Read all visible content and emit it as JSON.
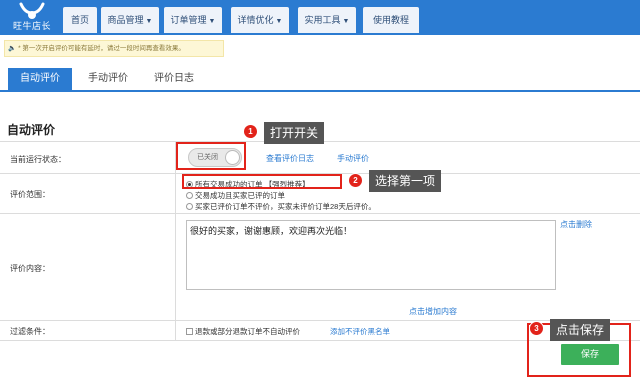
{
  "app": {
    "logo_text": "旺牛店长"
  },
  "nav": {
    "items": [
      {
        "label": "首页",
        "has_caret": false
      },
      {
        "label": "商品管理",
        "has_caret": true
      },
      {
        "label": "订单管理",
        "has_caret": true
      },
      {
        "label": "详情优化",
        "has_caret": true
      },
      {
        "label": "实用工具",
        "has_caret": true
      },
      {
        "label": "使用教程",
        "has_caret": false
      }
    ],
    "caret_icon": "chevron-down-icon"
  },
  "notice": {
    "text": "* 第一次开启评价可能有延时，请过一段时间再查看效果。",
    "icon": "speaker-icon"
  },
  "tabs": [
    {
      "label": "自动评价",
      "active": true
    },
    {
      "label": "手动评价",
      "active": false
    },
    {
      "label": "评价日志",
      "active": false
    }
  ],
  "section_title": "自动评价",
  "form": {
    "status": {
      "label": "当前运行状态：",
      "toggle_text": "已关闭",
      "toggle_on": false,
      "links": [
        "查看评价日志",
        "手动评价"
      ]
    },
    "scope": {
      "label": "评价范围：",
      "options": [
        {
          "text": "所有交易成功的订单 【强烈推荐】",
          "checked": true
        },
        {
          "text": "交易成功且买家已评的订单",
          "checked": false
        },
        {
          "text": "买家已评价订单不评价，买家未评价订单28天后评价。",
          "checked": false
        }
      ]
    },
    "content": {
      "label": "评价内容：",
      "value": "很好的买家，谢谢惠顾，欢迎再次光临！",
      "delete_link": "点击删除",
      "add_link": "点击增加内容"
    },
    "filter": {
      "label": "过滤条件：",
      "checkbox_text": "退款或部分退款订单不自动评价",
      "checked": false,
      "blacklist_link": "添加不评价黑名单"
    }
  },
  "save_label": "保存",
  "annotations": [
    {
      "number": "1",
      "text": "打开开关"
    },
    {
      "number": "2",
      "text": "选择第一项"
    },
    {
      "number": "3",
      "text": "点击保存"
    }
  ],
  "colors": {
    "header_blue": "#2b7bd1",
    "save_green": "#3cb05a",
    "annotation_red": "#e2231a",
    "callout_gray": "#555555"
  }
}
